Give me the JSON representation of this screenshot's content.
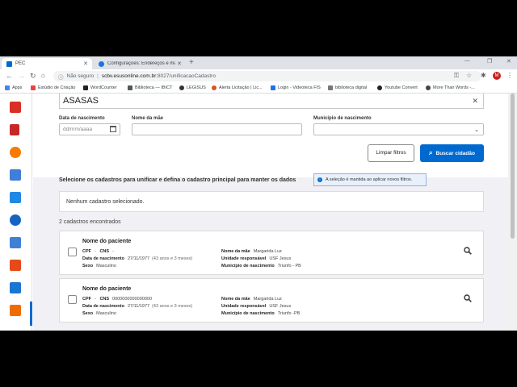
{
  "browser": {
    "tabs": [
      {
        "label": "PEC",
        "active": true
      },
      {
        "label": "Configurações: Endereços e mais",
        "active": false
      }
    ],
    "security_label": "Não seguro",
    "url_host": "scbv.esusonline.com.br",
    "url_path": ":8027/unificacaoCadastro",
    "profile_initial": "M",
    "bookmarks": [
      "Apps",
      "Estúdio de Criação",
      "WordCounter",
      "Biblioteca — IBICT",
      "LEGISUS",
      "Alerta Licitação | Lic...",
      "Login - Videoteca FIS",
      "biblioteca digital",
      "Youtube Convert",
      "More Than Words -..."
    ]
  },
  "filters": {
    "name_value": "ASASAS",
    "birth_label": "Data de nascimento",
    "birth_placeholder": "dd/mm/aaaa",
    "mother_label": "Nome da mãe",
    "mother_value": "",
    "birthplace_label": "Município de nascimento",
    "birthplace_value": "",
    "clear_button": "Limpar filtros",
    "search_button": "Buscar cidadão"
  },
  "selection": {
    "title": "Selecione os cadastros para unificar e defina o cadastro principal para manter os dados",
    "info": "A seleção é mantida ao aplicar novos filtros.",
    "empty": "Nenhum cadastro selecionado."
  },
  "results": {
    "count": "2 cadastros encontrados",
    "labels": {
      "cpf": "CPF",
      "cns": "CNS",
      "birth": "Data de nascimento",
      "sex": "Sexo",
      "mother": "Nome da mãe",
      "unit": "Unidade responsável",
      "city": "Município de nascimento"
    },
    "items": [
      {
        "name": "Nome do paciente",
        "cpf": "-",
        "cns": "-",
        "birth": "27/11/1977",
        "age": "(43 anos e 3 meses)",
        "sex": "Masculino",
        "mother": "Margarida Luz",
        "unit": "USF Jesus",
        "city": "Triunfo - PB"
      },
      {
        "name": "Nome do paciente",
        "cpf": "-",
        "cns": "0000000000000000",
        "birth": "27/11/1977",
        "age": "(43 anos e 3 meses)",
        "sex": "Masculino",
        "mother": "Margarida Luz",
        "unit": "USF Jesus",
        "city": "Triunfo -PB"
      }
    ]
  },
  "colors": {
    "primary": "#0069d0",
    "background": "#f0f0f5"
  },
  "icons": [
    "search-icon",
    "calendar-icon",
    "close-icon",
    "chevron-down-icon",
    "info-icon"
  ]
}
